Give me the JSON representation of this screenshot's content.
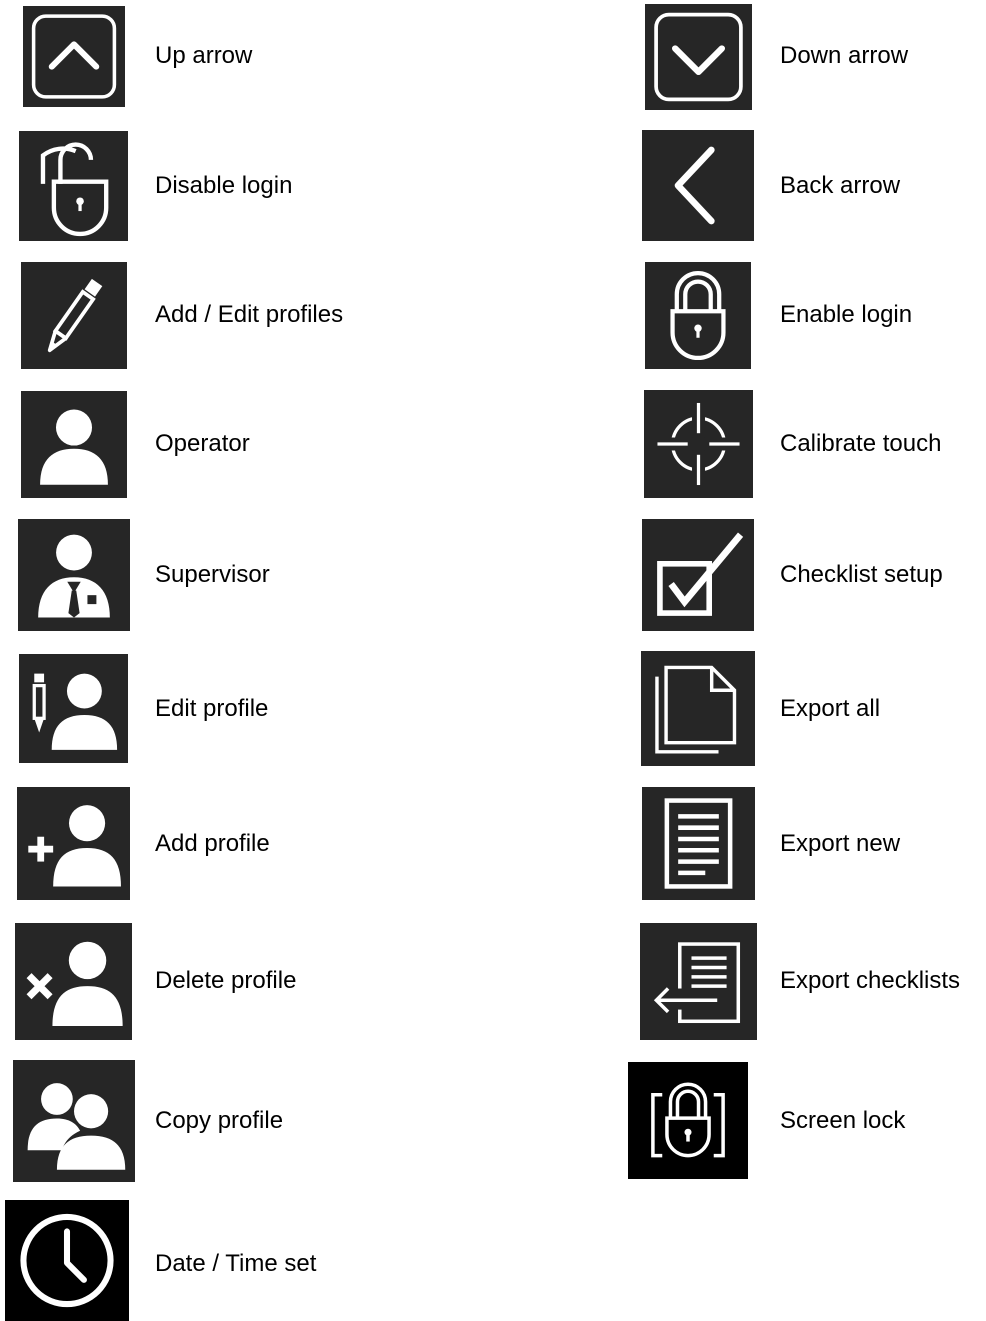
{
  "legend": {
    "left": [
      {
        "icon": "up-arrow-icon",
        "label": "Up arrow"
      },
      {
        "icon": "disable-login-icon",
        "label": "Disable login"
      },
      {
        "icon": "pencil-icon",
        "label": "Add / Edit profiles"
      },
      {
        "icon": "operator-icon",
        "label": "Operator"
      },
      {
        "icon": "supervisor-icon",
        "label": "Supervisor"
      },
      {
        "icon": "edit-profile-icon",
        "label": "Edit profile"
      },
      {
        "icon": "add-profile-icon",
        "label": "Add profile"
      },
      {
        "icon": "delete-profile-icon",
        "label": "Delete profile"
      },
      {
        "icon": "copy-profile-icon",
        "label": "Copy profile"
      },
      {
        "icon": "clock-icon",
        "label": "Date / Time set"
      }
    ],
    "right": [
      {
        "icon": "down-arrow-icon",
        "label": "Down arrow"
      },
      {
        "icon": "back-arrow-icon",
        "label": "Back arrow"
      },
      {
        "icon": "padlock-icon",
        "label": "Enable login"
      },
      {
        "icon": "crosshair-icon",
        "label": "Calibrate touch"
      },
      {
        "icon": "checkbox-icon",
        "label": "Checklist setup"
      },
      {
        "icon": "documents-icon",
        "label": "Export all"
      },
      {
        "icon": "document-lines-icon",
        "label": "Export new"
      },
      {
        "icon": "export-arrow-icon",
        "label": "Export checklists"
      },
      {
        "icon": "screen-lock-icon",
        "label": "Screen lock"
      }
    ]
  },
  "colors": {
    "tile": "#262626",
    "tile_black": "#000000",
    "glyph": "#ffffff"
  }
}
